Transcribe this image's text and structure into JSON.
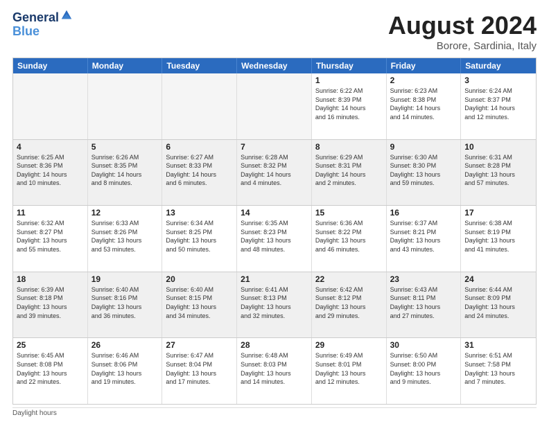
{
  "logo": {
    "line1": "General",
    "line2": "Blue"
  },
  "title": "August 2024",
  "subtitle": "Borore, Sardinia, Italy",
  "weekdays": [
    "Sunday",
    "Monday",
    "Tuesday",
    "Wednesday",
    "Thursday",
    "Friday",
    "Saturday"
  ],
  "footer": "Daylight hours",
  "weeks": [
    [
      {
        "day": "",
        "empty": true
      },
      {
        "day": "",
        "empty": true
      },
      {
        "day": "",
        "empty": true
      },
      {
        "day": "",
        "empty": true
      },
      {
        "day": "1",
        "info": "Sunrise: 6:22 AM\nSunset: 8:39 PM\nDaylight: 14 hours\nand 16 minutes."
      },
      {
        "day": "2",
        "info": "Sunrise: 6:23 AM\nSunset: 8:38 PM\nDaylight: 14 hours\nand 14 minutes."
      },
      {
        "day": "3",
        "info": "Sunrise: 6:24 AM\nSunset: 8:37 PM\nDaylight: 14 hours\nand 12 minutes."
      }
    ],
    [
      {
        "day": "4",
        "info": "Sunrise: 6:25 AM\nSunset: 8:36 PM\nDaylight: 14 hours\nand 10 minutes."
      },
      {
        "day": "5",
        "info": "Sunrise: 6:26 AM\nSunset: 8:35 PM\nDaylight: 14 hours\nand 8 minutes."
      },
      {
        "day": "6",
        "info": "Sunrise: 6:27 AM\nSunset: 8:33 PM\nDaylight: 14 hours\nand 6 minutes."
      },
      {
        "day": "7",
        "info": "Sunrise: 6:28 AM\nSunset: 8:32 PM\nDaylight: 14 hours\nand 4 minutes."
      },
      {
        "day": "8",
        "info": "Sunrise: 6:29 AM\nSunset: 8:31 PM\nDaylight: 14 hours\nand 2 minutes."
      },
      {
        "day": "9",
        "info": "Sunrise: 6:30 AM\nSunset: 8:30 PM\nDaylight: 13 hours\nand 59 minutes."
      },
      {
        "day": "10",
        "info": "Sunrise: 6:31 AM\nSunset: 8:28 PM\nDaylight: 13 hours\nand 57 minutes."
      }
    ],
    [
      {
        "day": "11",
        "info": "Sunrise: 6:32 AM\nSunset: 8:27 PM\nDaylight: 13 hours\nand 55 minutes."
      },
      {
        "day": "12",
        "info": "Sunrise: 6:33 AM\nSunset: 8:26 PM\nDaylight: 13 hours\nand 53 minutes."
      },
      {
        "day": "13",
        "info": "Sunrise: 6:34 AM\nSunset: 8:25 PM\nDaylight: 13 hours\nand 50 minutes."
      },
      {
        "day": "14",
        "info": "Sunrise: 6:35 AM\nSunset: 8:23 PM\nDaylight: 13 hours\nand 48 minutes."
      },
      {
        "day": "15",
        "info": "Sunrise: 6:36 AM\nSunset: 8:22 PM\nDaylight: 13 hours\nand 46 minutes."
      },
      {
        "day": "16",
        "info": "Sunrise: 6:37 AM\nSunset: 8:21 PM\nDaylight: 13 hours\nand 43 minutes."
      },
      {
        "day": "17",
        "info": "Sunrise: 6:38 AM\nSunset: 8:19 PM\nDaylight: 13 hours\nand 41 minutes."
      }
    ],
    [
      {
        "day": "18",
        "info": "Sunrise: 6:39 AM\nSunset: 8:18 PM\nDaylight: 13 hours\nand 39 minutes."
      },
      {
        "day": "19",
        "info": "Sunrise: 6:40 AM\nSunset: 8:16 PM\nDaylight: 13 hours\nand 36 minutes."
      },
      {
        "day": "20",
        "info": "Sunrise: 6:40 AM\nSunset: 8:15 PM\nDaylight: 13 hours\nand 34 minutes."
      },
      {
        "day": "21",
        "info": "Sunrise: 6:41 AM\nSunset: 8:13 PM\nDaylight: 13 hours\nand 32 minutes."
      },
      {
        "day": "22",
        "info": "Sunrise: 6:42 AM\nSunset: 8:12 PM\nDaylight: 13 hours\nand 29 minutes."
      },
      {
        "day": "23",
        "info": "Sunrise: 6:43 AM\nSunset: 8:11 PM\nDaylight: 13 hours\nand 27 minutes."
      },
      {
        "day": "24",
        "info": "Sunrise: 6:44 AM\nSunset: 8:09 PM\nDaylight: 13 hours\nand 24 minutes."
      }
    ],
    [
      {
        "day": "25",
        "info": "Sunrise: 6:45 AM\nSunset: 8:08 PM\nDaylight: 13 hours\nand 22 minutes."
      },
      {
        "day": "26",
        "info": "Sunrise: 6:46 AM\nSunset: 8:06 PM\nDaylight: 13 hours\nand 19 minutes."
      },
      {
        "day": "27",
        "info": "Sunrise: 6:47 AM\nSunset: 8:04 PM\nDaylight: 13 hours\nand 17 minutes."
      },
      {
        "day": "28",
        "info": "Sunrise: 6:48 AM\nSunset: 8:03 PM\nDaylight: 13 hours\nand 14 minutes."
      },
      {
        "day": "29",
        "info": "Sunrise: 6:49 AM\nSunset: 8:01 PM\nDaylight: 13 hours\nand 12 minutes."
      },
      {
        "day": "30",
        "info": "Sunrise: 6:50 AM\nSunset: 8:00 PM\nDaylight: 13 hours\nand 9 minutes."
      },
      {
        "day": "31",
        "info": "Sunrise: 6:51 AM\nSunset: 7:58 PM\nDaylight: 13 hours\nand 7 minutes."
      }
    ]
  ]
}
